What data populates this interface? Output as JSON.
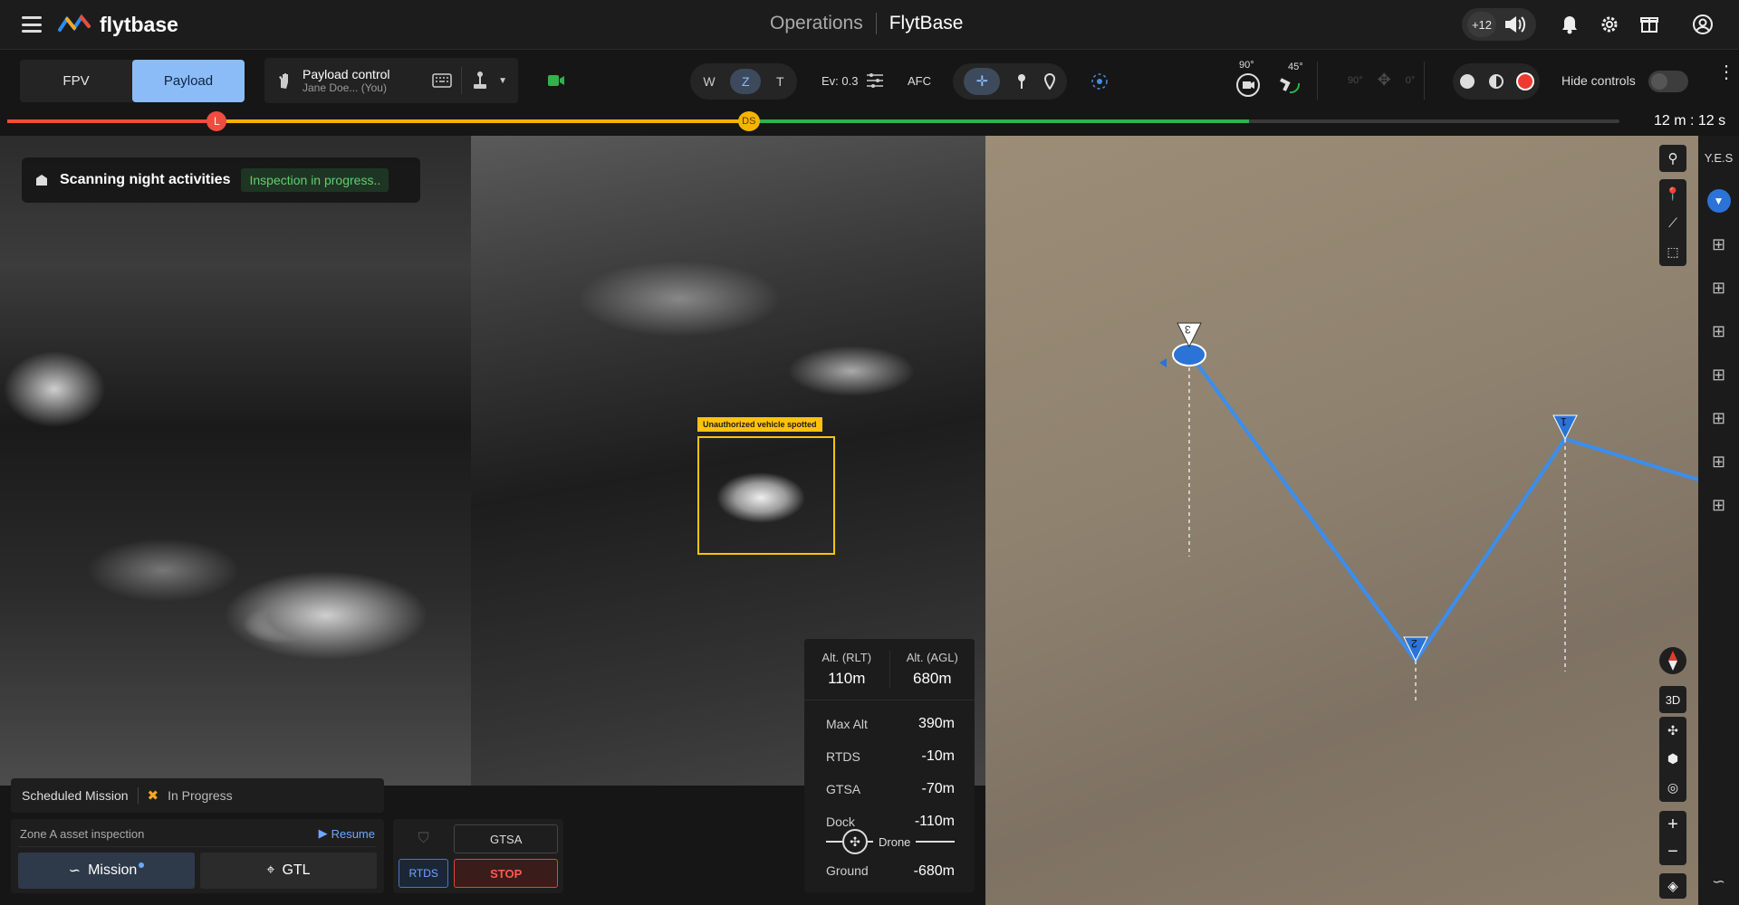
{
  "app": {
    "logo_text": "flytbase",
    "title_left": "Operations",
    "title_right": "FlytBase",
    "notif_count": "+12"
  },
  "toolbar": {
    "view_tabs": [
      "FPV",
      "Payload"
    ],
    "active_tab": "Payload",
    "payload_control_title": "Payload control",
    "payload_control_user": "Jane Doe... (You)",
    "zoom_modes": [
      "W",
      "Z",
      "T"
    ],
    "active_zoom": "Z",
    "ev_label": "Ev: 0.3",
    "afc_label": "AFC",
    "gimbal_pitch": "90°",
    "gimbal_yaw": "45°",
    "gimbal_dim": [
      "90°",
      "0°"
    ],
    "hide_controls_label": "Hide controls"
  },
  "timeline": {
    "marker_l": "L",
    "marker_ds": "DS",
    "time_remaining": "12 m : 12 s",
    "progress_red_end": 0.13,
    "progress_yellow_end": 0.46,
    "progress_green_end": 0.77,
    "colors": {
      "red": "#ee4d3f",
      "yellow": "#f6b400",
      "green": "#2fb34a"
    }
  },
  "video": {
    "status_title": "Scanning night activities",
    "status_badge": "Inspection in progress..",
    "detection_label": "Unauthorized vehicle spotted"
  },
  "mission": {
    "label": "Scheduled Mission",
    "status": "In Progress",
    "name": "Zone A asset inspection",
    "resume": "Resume",
    "mission_btn": "Mission",
    "gtl_btn": "GTL"
  },
  "actions": {
    "gtsa": "GTSA",
    "rtds": "RTDS",
    "stop": "STOP"
  },
  "altitude": {
    "rlt_label": "Alt. (RLT)",
    "rlt_value": "110m",
    "agl_label": "Alt. (AGL)",
    "agl_value": "680m",
    "rows": [
      {
        "label": "Max Alt",
        "value": "390m"
      },
      {
        "label": "RTDS",
        "value": "-10m"
      },
      {
        "label": "GTSA",
        "value": "-70m"
      },
      {
        "label": "Dock",
        "value": "-110m"
      }
    ],
    "drone_label": "Drone",
    "ground_label": "Ground",
    "ground_value": "-680m"
  },
  "map": {
    "waypoints": [
      "1",
      "2",
      "3"
    ],
    "view_3d": "3D",
    "rail_label": "Y.E.S",
    "route_color": "#3a8ef0"
  }
}
